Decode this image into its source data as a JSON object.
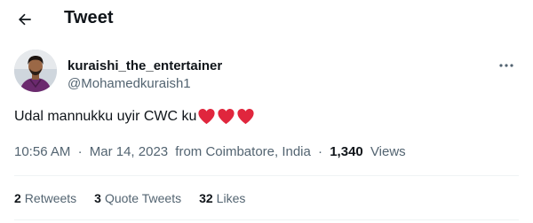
{
  "header": {
    "title": "Tweet",
    "back_icon": "arrow-left-icon"
  },
  "author": {
    "name": "kuraishi_the_entertainer",
    "handle": "@Mohamedkuraish1",
    "more_icon": "more-horizontal-icon"
  },
  "tweet": {
    "text": "Udal mannukku uyir CWC ku",
    "emoji": [
      "red-heart",
      "red-heart",
      "red-heart"
    ],
    "heart_color": "#e0263d"
  },
  "meta": {
    "time": "10:56 AM",
    "separator": "·",
    "date": "Mar 14, 2023",
    "location": "from Coimbatore, India",
    "views_count": "1,340",
    "views_label": "Views"
  },
  "stats": {
    "retweets_count": "2",
    "retweets_label": "Retweets",
    "quotes_count": "3",
    "quotes_label": "Quote Tweets",
    "likes_count": "32",
    "likes_label": "Likes"
  },
  "colors": {
    "text_primary": "#0f1419",
    "text_secondary": "#536471",
    "divider": "#eff3f4"
  }
}
